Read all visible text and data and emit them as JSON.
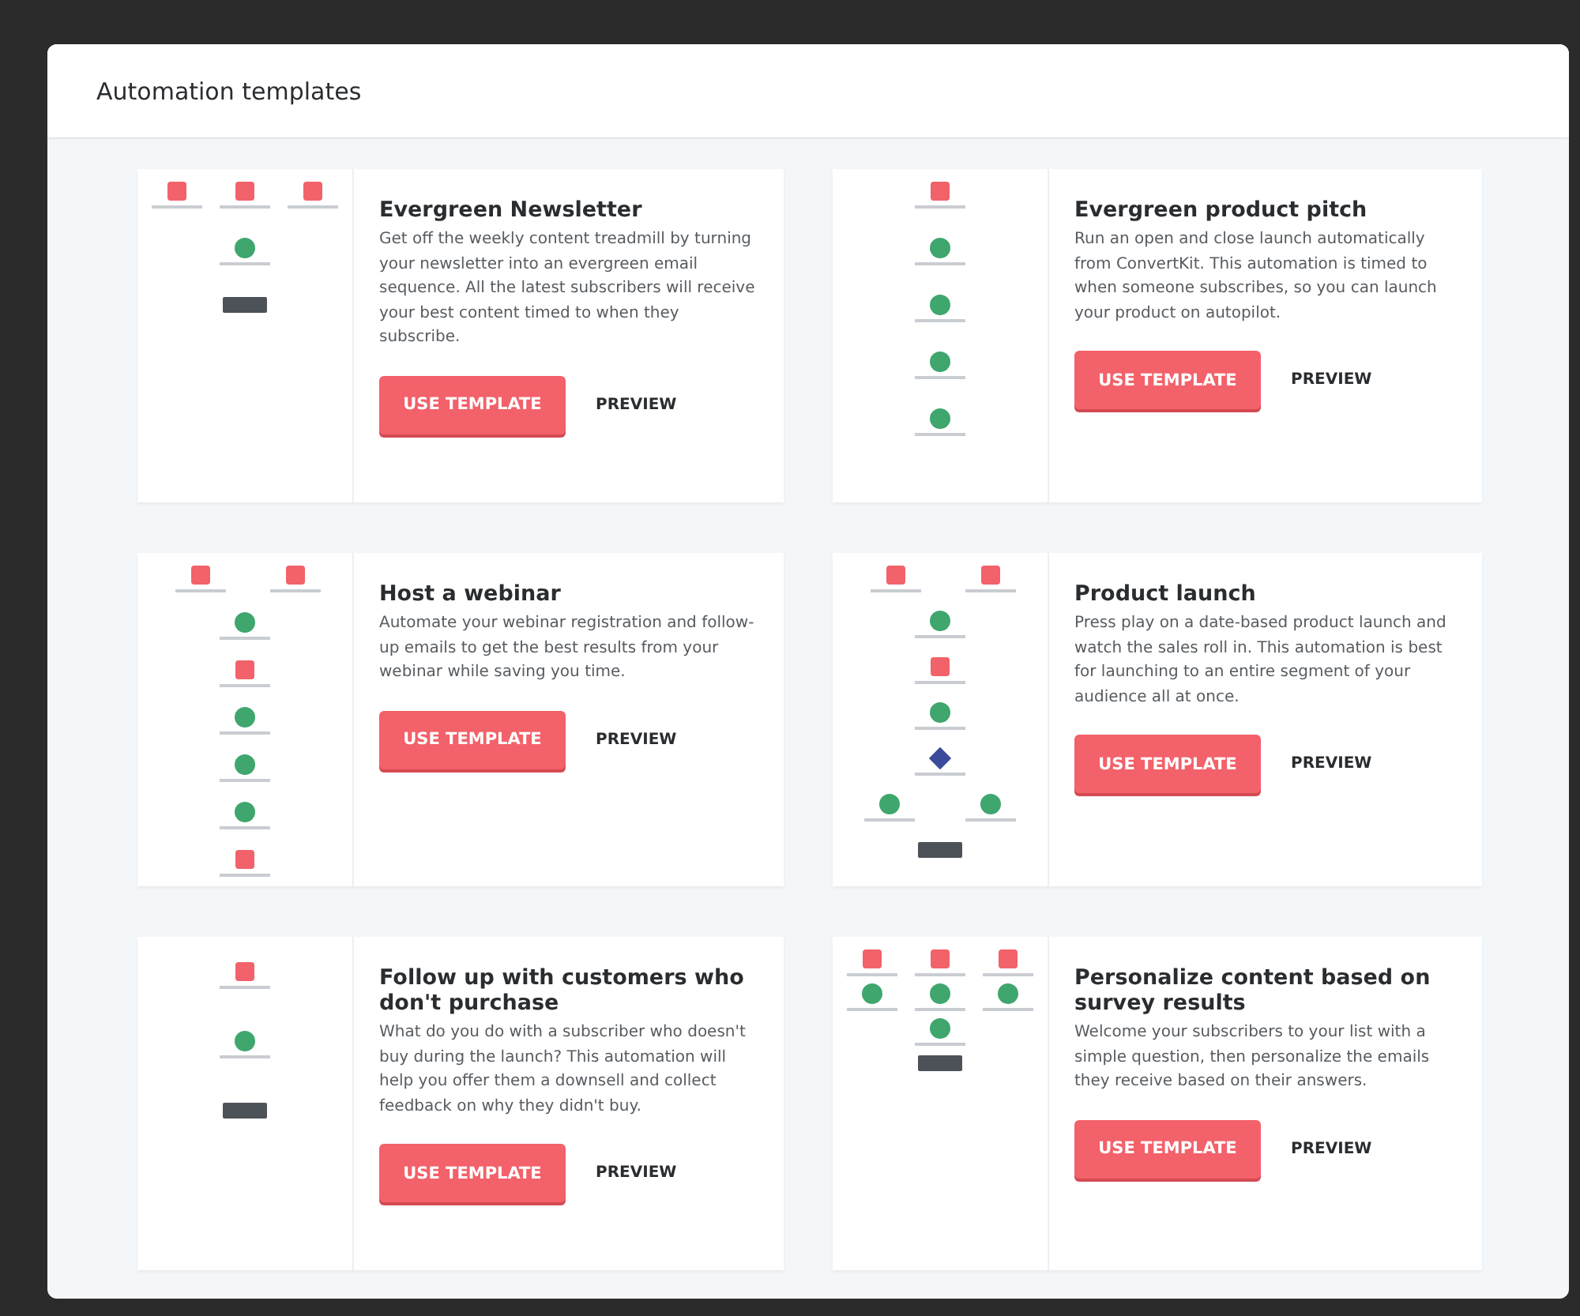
{
  "panel": {
    "title": "Automation templates"
  },
  "templates": [
    {
      "title": "Evergreen Newsletter",
      "description": "Get off the weekly content treadmill by turning your newsletter into an evergreen email sequence. All the latest subscribers will receive your best content timed to when they subscribe.",
      "primary_button": "USE TEMPLATE",
      "secondary_button": "PREVIEW"
    },
    {
      "title": "Evergreen product pitch",
      "description": "Run an open and close launch automatically from ConvertKit. This automation is timed to when someone subscribes, so you can launch your product on autopilot.",
      "primary_button": "USE TEMPLATE",
      "secondary_button": "PREVIEW"
    },
    {
      "title": "Host a webinar",
      "description": "Automate your webinar registration and follow-up emails to get the best results from your webinar while saving you time.",
      "primary_button": "USE TEMPLATE",
      "secondary_button": "PREVIEW"
    },
    {
      "title": "Product launch",
      "description": "Press play on a date-based product launch and watch the sales roll in. This automation is best for launching to an entire segment of your audience all at once.",
      "primary_button": "USE TEMPLATE",
      "secondary_button": "PREVIEW"
    },
    {
      "title": "Follow up with customers who don't purchase",
      "description": "What do you do with a subscriber who doesn't buy during the launch? This automation will help you offer them a downsell and collect feedback on why they didn't buy.",
      "primary_button": "USE TEMPLATE",
      "secondary_button": "PREVIEW"
    },
    {
      "title": "Personalize content based on survey results",
      "description": "Welcome your subscribers to your list with a simple question, then personalize the emails they receive based on their answers.",
      "primary_button": "USE TEMPLATE",
      "secondary_button": "PREVIEW"
    }
  ]
}
